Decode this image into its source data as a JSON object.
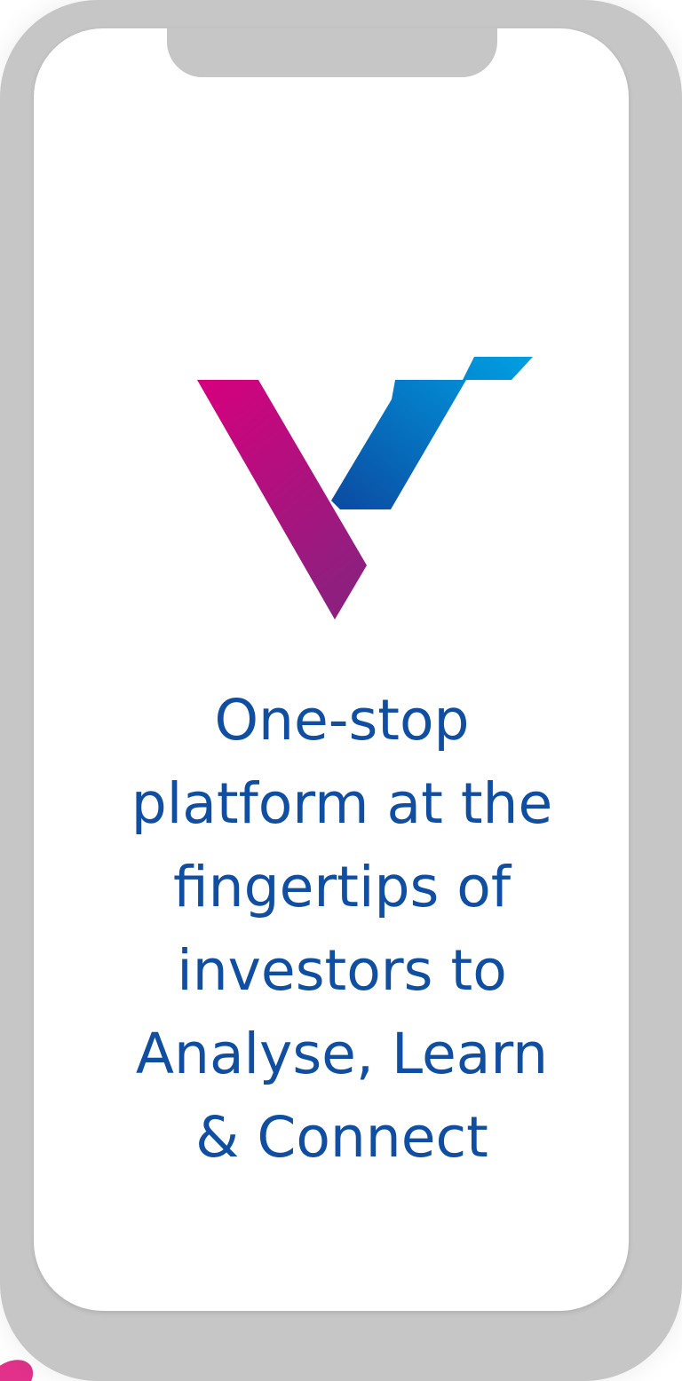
{
  "app": {
    "logo_icon": "v-brand-logo-icon",
    "brand_colors": {
      "magenta": "#d6007e",
      "purple": "#8f1f7f",
      "blue_dark": "#0b4aa1",
      "blue_light": "#00a0e3",
      "text_blue": "#0f4ea1"
    }
  },
  "splash": {
    "tagline_lines": [
      "One-stop",
      "platform at the",
      "fingertips of",
      "investors to",
      "Analyse, Learn",
      "& Connect"
    ]
  }
}
